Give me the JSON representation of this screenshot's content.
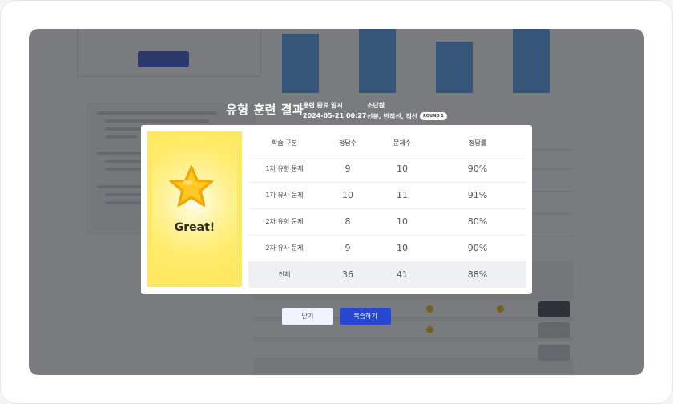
{
  "modal": {
    "title": "유형 훈련 결과",
    "completed_label": "훈련 완료 일시",
    "completed_value": "2024-05-21 00:27",
    "unit_label": "소단원",
    "unit_value": "선분, 반직선, 직선",
    "round_badge": "ROUND 1",
    "badge_text": "Great!",
    "close_label": "닫기",
    "review_label": "복습하기"
  },
  "table": {
    "headers": [
      "학습 구분",
      "정답수",
      "문제수",
      "정답률"
    ],
    "rows": [
      [
        "1차 유형 문제",
        "9",
        "10",
        "90%"
      ],
      [
        "1차 유사 문제",
        "10",
        "11",
        "91%"
      ],
      [
        "2차 유형 문제",
        "8",
        "10",
        "80%"
      ],
      [
        "2차 유사 문제",
        "9",
        "10",
        "90%"
      ]
    ],
    "total": [
      "전체",
      "36",
      "41",
      "88%"
    ]
  },
  "colors": {
    "primary": "#2a47d0",
    "badge_bg": "#ffe964",
    "star": "#f7b500"
  },
  "icons": {
    "badge": "star-icon"
  }
}
